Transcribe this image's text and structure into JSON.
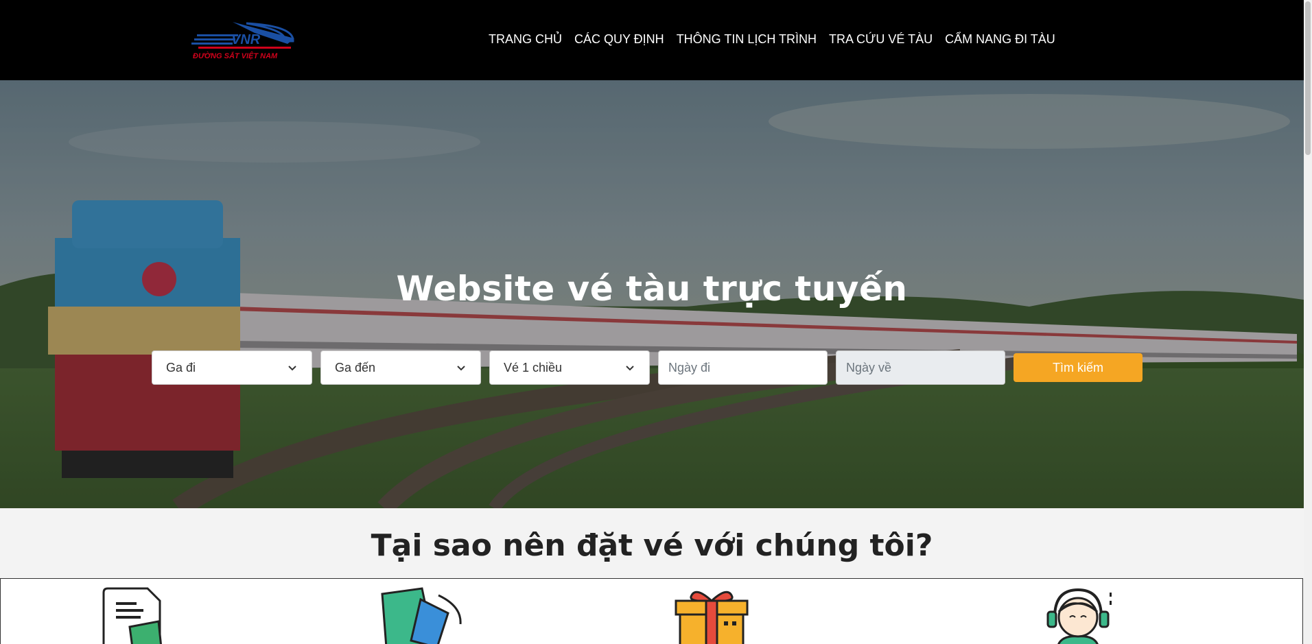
{
  "header": {
    "logo_text": "VNR",
    "logo_subtext": "ĐƯỜNG SẮT VIỆT NAM",
    "nav": [
      {
        "label": "TRANG CHỦ"
      },
      {
        "label": "CÁC QUY ĐỊNH"
      },
      {
        "label": "THÔNG TIN LỊCH TRÌNH"
      },
      {
        "label": "TRA CỨU VÉ TÀU"
      },
      {
        "label": "CẨM NANG ĐI TÀU"
      }
    ]
  },
  "hero": {
    "title": "Website vé tàu trực tuyến",
    "search": {
      "from_selected": "Ga đi",
      "to_selected": "Ga đến",
      "trip_type_selected": "Vé 1 chiều",
      "depart_placeholder": "Ngày đi",
      "return_placeholder": "Ngày về",
      "submit_label": "Tìm kiếm"
    }
  },
  "why": {
    "title": "Tại sao nên đặt vé với chúng tôi?",
    "icons": [
      "document-icon",
      "paint-bucket-icon",
      "gift-box-icon",
      "customer-support-icon"
    ]
  },
  "colors": {
    "header_bg": "#000000",
    "accent": "#f5a623",
    "logo_blue": "#1a4fa3",
    "logo_red": "#d0021b"
  }
}
